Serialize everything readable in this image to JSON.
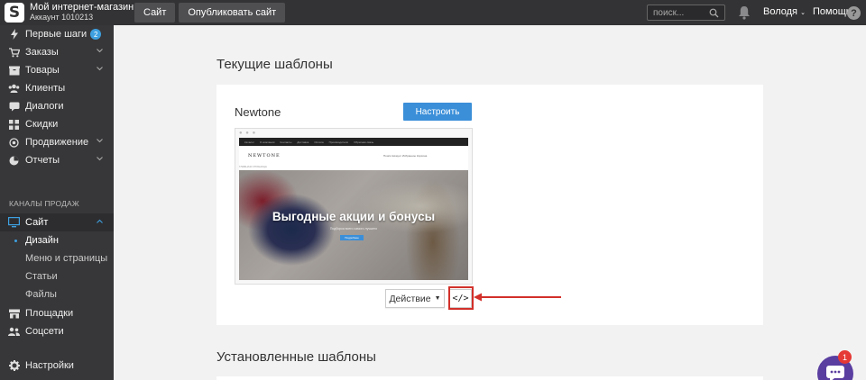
{
  "header": {
    "store_name": "Мой интернет-магазин",
    "account": "Аккаунт 1010213",
    "site_button": "Сайт",
    "publish_button": "Опубликовать сайт",
    "search_placeholder": "поиск...",
    "user": "Володя",
    "help": "Помощь",
    "help_icon": "?"
  },
  "sidebar": {
    "items": [
      {
        "label": "Первые шаги",
        "badge": "2",
        "icon": "bolt-icon"
      },
      {
        "label": "Заказы",
        "icon": "cart-icon"
      },
      {
        "label": "Товары",
        "icon": "box-icon"
      },
      {
        "label": "Клиенты",
        "icon": "users-icon"
      },
      {
        "label": "Диалоги",
        "icon": "chat-icon"
      },
      {
        "label": "Скидки",
        "icon": "grid-icon"
      },
      {
        "label": "Продвижение",
        "icon": "target-icon"
      },
      {
        "label": "Отчеты",
        "icon": "pie-icon"
      }
    ],
    "section": "КАНАЛЫ ПРОДАЖ",
    "channel": {
      "label": "Сайт",
      "icon": "monitor-icon"
    },
    "subitems": [
      "Дизайн",
      "Меню и страницы",
      "Статьи",
      "Файлы"
    ],
    "bottom": [
      {
        "label": "Площадки",
        "icon": "store-icon"
      },
      {
        "label": "Соцсети",
        "icon": "people-icon"
      },
      {
        "label": "Настройки",
        "icon": "gear-icon"
      }
    ]
  },
  "main": {
    "current_title": "Текущие шаблоны",
    "installed_title": "Установленные шаблоны",
    "template_name": "Newtone",
    "configure_button": "Настроить",
    "action_button": "Действие",
    "code_button": "</>",
    "preview": {
      "dots": "● ● ●",
      "topbar_links": [
        "Каталог",
        "О компании",
        "Контакты",
        "Доставка",
        "Оплата",
        "Производители",
        "Обратная связь"
      ],
      "logo": "NEWTONE",
      "nav": "Поиск   Аккаунт   Избранное   Корзина",
      "breadcrumb": "ГЛАВНАЯ СТРАНИЦА",
      "hero_title": "Выгодные акции и бонусы",
      "hero_sub": "Подборка всего самого лучшего",
      "hero_button": "Подробнее"
    }
  },
  "chat": {
    "badge": "1"
  },
  "colors": {
    "accent": "#3b8fd9",
    "highlight": "#d2302a",
    "chat": "#5a3ea0"
  }
}
